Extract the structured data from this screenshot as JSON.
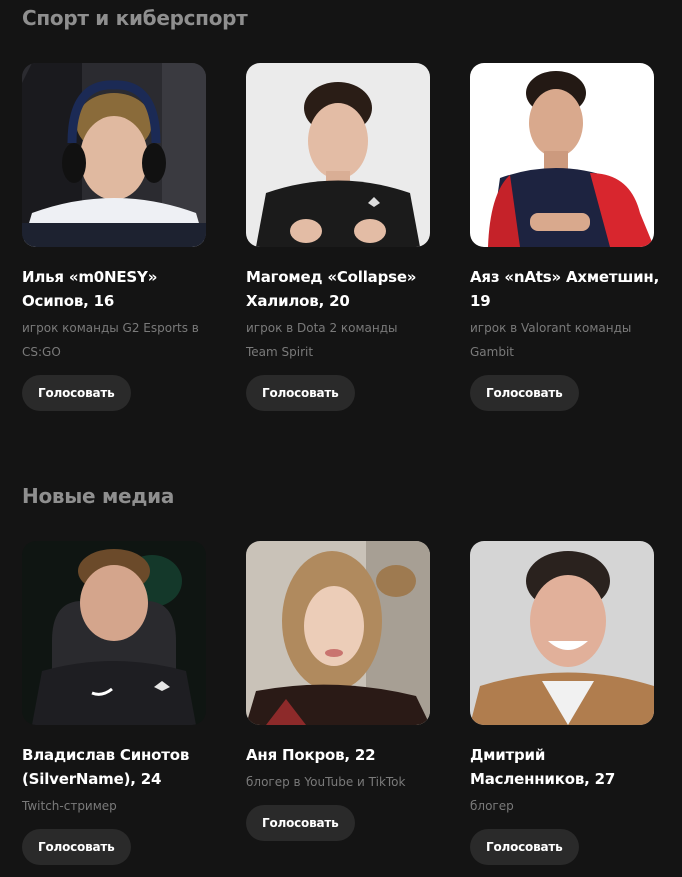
{
  "sections": [
    {
      "title": "Спорт и киберспорт",
      "cards": [
        {
          "name": "Илья «m0NESY» Осипов, 16",
          "desc": "игрок команды G2 Esports в CS:GO",
          "button": "Голосовать"
        },
        {
          "name": "Магомед «Collapse» Халилов, 20",
          "desc": "игрок в Dota 2 команды Team Spirit",
          "button": "Голосовать"
        },
        {
          "name": "Аяз «nAts» Ахметшин, 19",
          "desc": "игрок в Valorant команды Gambit",
          "button": "Голосовать"
        }
      ]
    },
    {
      "title": "Новые медиа",
      "cards": [
        {
          "name": "Владислав Синотов (SilverName), 24",
          "desc": "Twitch-стример",
          "button": "Голосовать"
        },
        {
          "name": "Аня Покров, 22",
          "desc": "блогер в YouTube и TikTok",
          "button": "Голосовать"
        },
        {
          "name": "Дмитрий Масленников, 27",
          "desc": "блогер",
          "button": "Голосовать"
        }
      ]
    }
  ],
  "colors": {
    "background": "#141414",
    "section_title": "#8f8f8f",
    "button_bg": "#2a2a2a",
    "desc_text": "#7a7a7a"
  }
}
